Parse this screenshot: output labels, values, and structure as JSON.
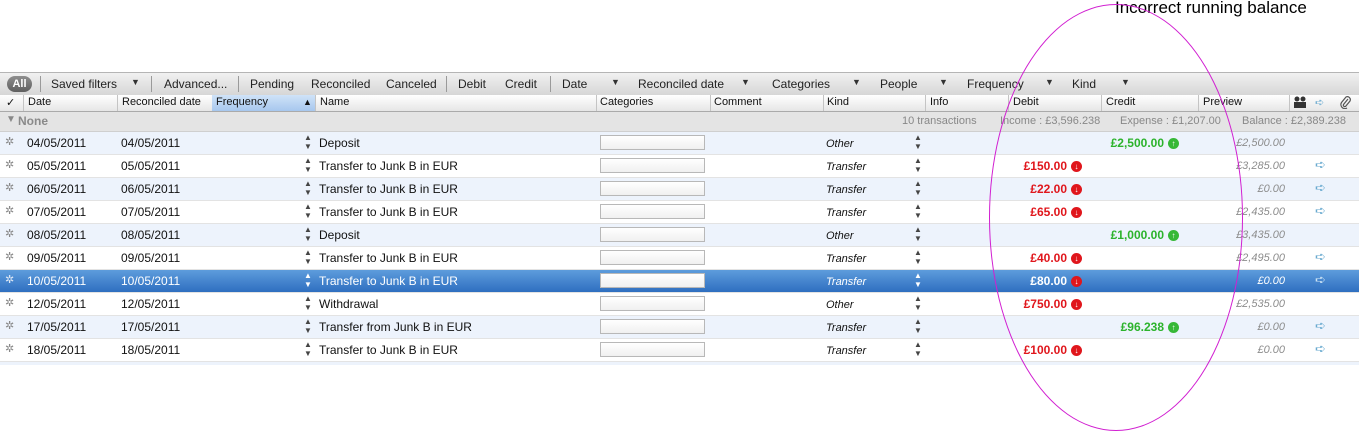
{
  "annotation": {
    "title": "Incorrect running balance"
  },
  "filterbar": {
    "all_label": "All",
    "saved_filters": "Saved filters",
    "advanced": "Advanced...",
    "pending": "Pending",
    "reconciled": "Reconciled",
    "canceled": "Canceled",
    "debit": "Debit",
    "credit": "Credit",
    "date": "Date",
    "reconciled_date": "Reconciled date",
    "categories": "Categories",
    "people": "People",
    "frequency": "Frequency",
    "kind": "Kind"
  },
  "columns": {
    "check": "✓",
    "date": "Date",
    "reconciled_date": "Reconciled date",
    "frequency": "Frequency",
    "name": "Name",
    "categories": "Categories",
    "comment": "Comment",
    "kind": "Kind",
    "info": "Info",
    "debit": "Debit",
    "credit": "Credit",
    "preview": "Preview"
  },
  "group": {
    "name": "None",
    "count": "10 transactions",
    "income": "Income : £3,596.238",
    "expense": "Expense : £1,207.00",
    "balance": "Balance : £2,389.238"
  },
  "rows": [
    {
      "date": "04/05/2011",
      "reconciled": "04/05/2011",
      "name": "Deposit",
      "kind": "Other",
      "debit": "",
      "credit": "£2,500.00",
      "preview": "£2,500.00",
      "transfer": false
    },
    {
      "date": "05/05/2011",
      "reconciled": "05/05/2011",
      "name": "Transfer to Junk B in EUR",
      "kind": "Transfer",
      "debit": "£150.00",
      "credit": "",
      "preview": "£3,285.00",
      "transfer": true
    },
    {
      "date": "06/05/2011",
      "reconciled": "06/05/2011",
      "name": "Transfer to Junk B in EUR",
      "kind": "Transfer",
      "debit": "£22.00",
      "credit": "",
      "preview": "£0.00",
      "transfer": true
    },
    {
      "date": "07/05/2011",
      "reconciled": "07/05/2011",
      "name": "Transfer to Junk B in EUR",
      "kind": "Transfer",
      "debit": "£65.00",
      "credit": "",
      "preview": "£2,435.00",
      "transfer": true
    },
    {
      "date": "08/05/2011",
      "reconciled": "08/05/2011",
      "name": "Deposit",
      "kind": "Other",
      "debit": "",
      "credit": "£1,000.00",
      "preview": "£3,435.00",
      "transfer": false
    },
    {
      "date": "09/05/2011",
      "reconciled": "09/05/2011",
      "name": "Transfer to Junk B in EUR",
      "kind": "Transfer",
      "debit": "£40.00",
      "credit": "",
      "preview": "£2,495.00",
      "transfer": true
    },
    {
      "date": "10/05/2011",
      "reconciled": "10/05/2011",
      "name": "Transfer to Junk B in EUR",
      "kind": "Transfer",
      "debit": "£80.00",
      "credit": "",
      "preview": "£0.00",
      "transfer": true,
      "selected": true
    },
    {
      "date": "12/05/2011",
      "reconciled": "12/05/2011",
      "name": "Withdrawal",
      "kind": "Other",
      "debit": "£750.00",
      "credit": "",
      "preview": "£2,535.00",
      "transfer": false
    },
    {
      "date": "17/05/2011",
      "reconciled": "17/05/2011",
      "name": "Transfer from Junk B in EUR",
      "kind": "Transfer",
      "debit": "",
      "credit": "£96.238",
      "preview": "£0.00",
      "transfer": true
    },
    {
      "date": "18/05/2011",
      "reconciled": "18/05/2011",
      "name": "Transfer to Junk B in EUR",
      "kind": "Transfer",
      "debit": "£100.00",
      "credit": "",
      "preview": "£0.00",
      "transfer": true
    }
  ],
  "icons": {
    "row_status": "spinner-icon",
    "transfer": "transfer-arrow-icon",
    "debit_badge": "down-arrow-icon",
    "credit_badge": "up-arrow-icon",
    "people_column": "people-icon",
    "attachment_column": "paperclip-icon"
  },
  "colors": {
    "debit": "#e0161c",
    "credit": "#2cb32c",
    "selection": "#3b7dd0",
    "annotation": "#d11fd1"
  }
}
